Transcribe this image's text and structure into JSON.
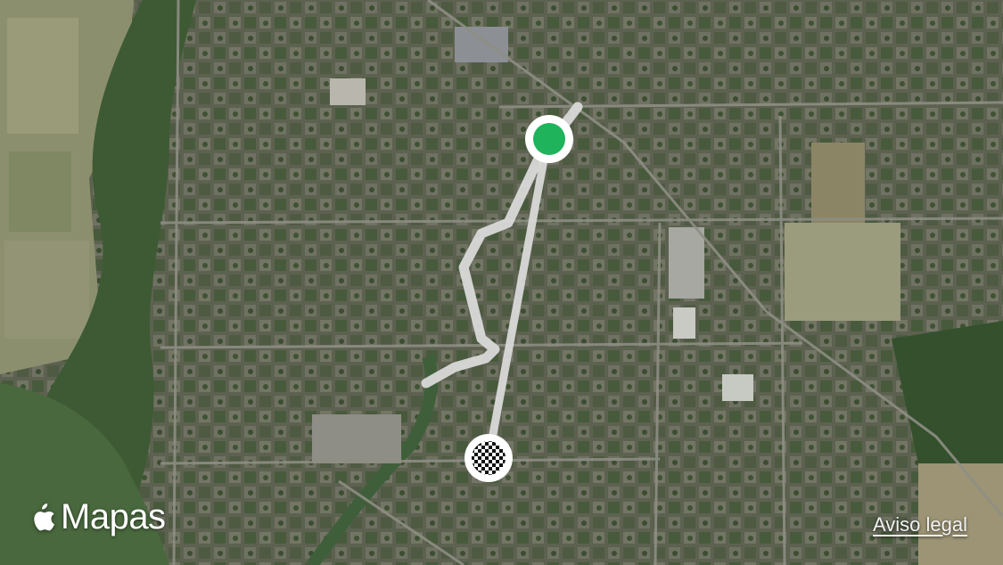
{
  "map": {
    "type": "satellite",
    "brand_label": "Mapas",
    "legal_link": "Aviso legal",
    "route_color": "#d9d9d9",
    "start_color": "#1fb35c",
    "end_marker": "checkered-flag"
  }
}
